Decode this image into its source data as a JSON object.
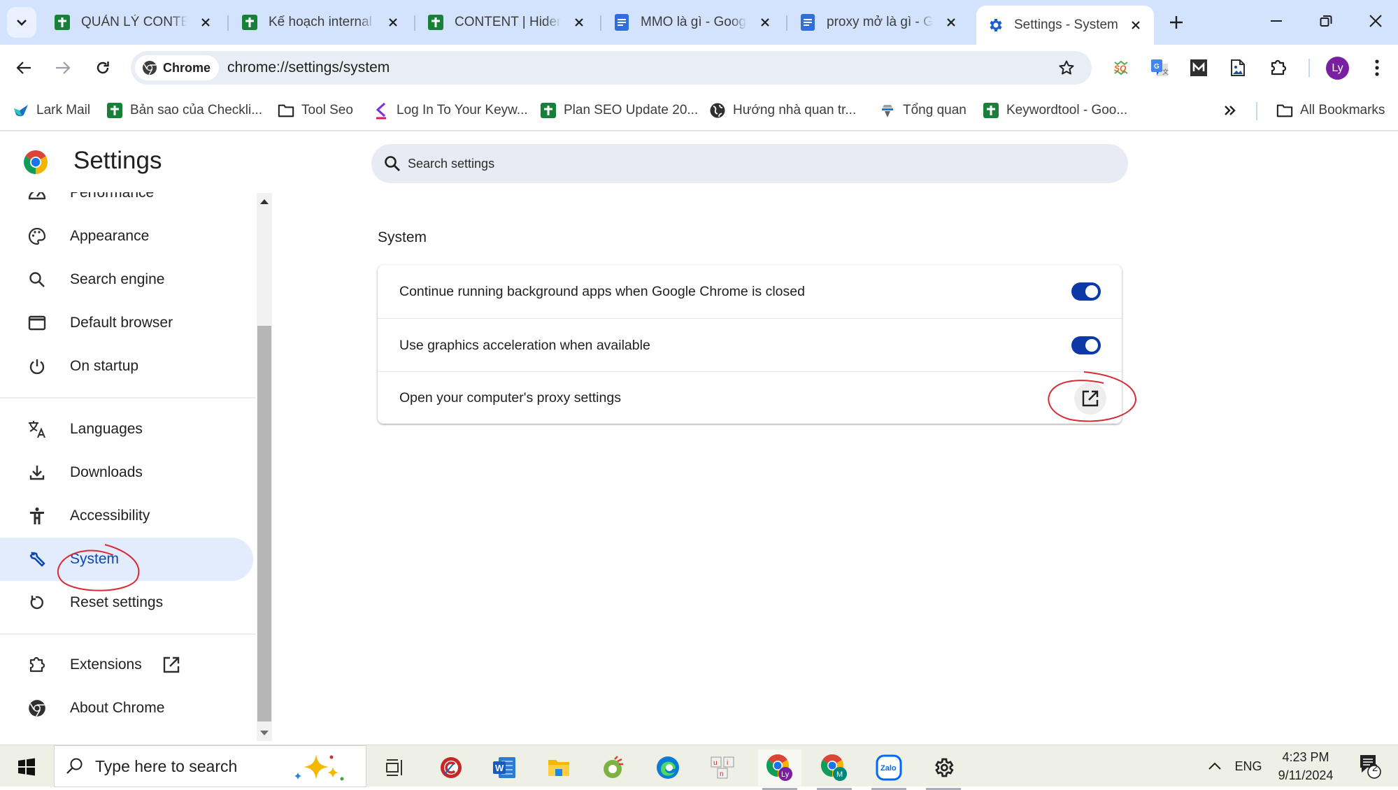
{
  "browser": {
    "tabs": [
      {
        "title": "QUẢN LÝ CONTENT",
        "favicon": "google-sheets-icon",
        "active": false
      },
      {
        "title": "Kế hoạch internal link",
        "favicon": "google-sheets-icon",
        "active": false
      },
      {
        "title": "CONTENT | Hidemyacc",
        "favicon": "google-sheets-icon",
        "active": false
      },
      {
        "title": "MMO là gì - Google Docs",
        "favicon": "google-docs-icon",
        "active": false
      },
      {
        "title": "proxy mở là gì - Google Docs",
        "favicon": "google-docs-icon",
        "active": false
      },
      {
        "title": "Settings - System",
        "favicon": "gear-icon",
        "active": true
      }
    ],
    "omnibox": {
      "chip_label": "Chrome",
      "url": "chrome://settings/system"
    },
    "profile_initials": "Ly",
    "extensions": [
      "seoquake-icon",
      "google-translate-icon",
      "m-extension-icon",
      "image-file-icon",
      "puzzle-extensions-icon"
    ],
    "bookmarks": [
      {
        "label": "Lark Mail",
        "icon": "lark-icon"
      },
      {
        "label": "Bản sao của Checkli...",
        "icon": "google-sheets-icon"
      },
      {
        "label": "Tool Seo",
        "icon": "folder-icon"
      },
      {
        "label": "Log In To Your Keyw...",
        "icon": "keyword-tool-icon"
      },
      {
        "label": "Plan SEO Update 20...",
        "icon": "google-sheets-icon"
      },
      {
        "label": "Hướng nhà quan tr...",
        "icon": "globe-icon"
      },
      {
        "label": "Tổng quan",
        "icon": "tong-quan-icon"
      },
      {
        "label": "Keywordtool - Goo...",
        "icon": "google-sheets-icon"
      }
    ],
    "all_bookmarks_label": "All Bookmarks"
  },
  "settings": {
    "title": "Settings",
    "search_placeholder": "Search settings",
    "sidebar": [
      {
        "label": "Performance",
        "icon": "performance-gauge-icon",
        "active": false
      },
      {
        "label": "Appearance",
        "icon": "palette-icon",
        "active": false
      },
      {
        "label": "Search engine",
        "icon": "search-icon",
        "active": false
      },
      {
        "label": "Default browser",
        "icon": "browser-window-icon",
        "active": false
      },
      {
        "label": "On startup",
        "icon": "power-icon",
        "active": false
      },
      {
        "label": "Languages",
        "icon": "translate-icon",
        "active": false
      },
      {
        "label": "Downloads",
        "icon": "download-icon",
        "active": false
      },
      {
        "label": "Accessibility",
        "icon": "accessibility-icon",
        "active": false
      },
      {
        "label": "System",
        "icon": "wrench-icon",
        "active": true
      },
      {
        "label": "Reset settings",
        "icon": "reset-icon",
        "active": false
      },
      {
        "label": "Extensions",
        "icon": "puzzle-icon",
        "active": false,
        "external": true
      },
      {
        "label": "About Chrome",
        "icon": "chrome-logo-icon",
        "active": false
      }
    ],
    "section_title": "System",
    "rows": [
      {
        "label": "Continue running background apps when Google Chrome is closed",
        "control": "toggle",
        "on": true
      },
      {
        "label": "Use graphics acceleration when available",
        "control": "toggle",
        "on": true
      },
      {
        "label": "Open your computer's proxy settings",
        "control": "external-link"
      }
    ],
    "accent_color": "#0b3aa8",
    "annotation_color": "#d92b35"
  },
  "taskbar": {
    "search_placeholder": "Type here to search",
    "apps": [
      "task-view-icon",
      "ccleaner-icon",
      "word-icon",
      "file-explorer-icon",
      "coc-coc-icon",
      "edge-icon",
      "unikey-icon",
      "chrome-ly-icon",
      "chrome-m-icon",
      "zalo-icon",
      "settings-gear-icon"
    ],
    "language": "ENG",
    "time": "4:23 PM",
    "date": "9/11/2024",
    "notification_count": "2"
  }
}
